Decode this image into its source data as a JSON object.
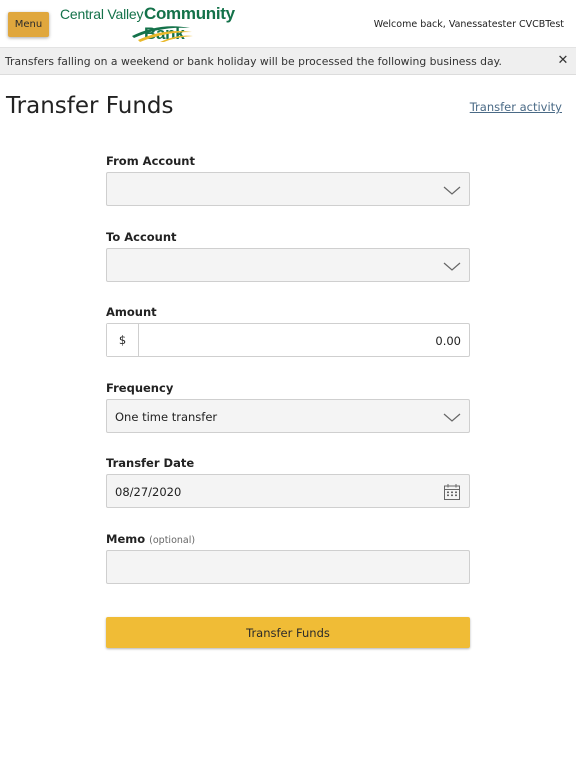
{
  "header": {
    "menu_label": "Menu",
    "logo_text_1": "Central Valley",
    "logo_text_2": "Community Bank",
    "welcome": "Welcome back, Vanessatester CVCBTest",
    "logo_colors": {
      "green": "#14724a",
      "yellow": "#e9b92b"
    }
  },
  "banner": {
    "message": "Transfers falling on a weekend or bank holiday will be processed the following business day.",
    "close_icon": "close-icon"
  },
  "page": {
    "title": "Transfer Funds",
    "activity_link": "Transfer activity"
  },
  "form": {
    "from_account": {
      "label": "From Account",
      "value": ""
    },
    "to_account": {
      "label": "To Account",
      "value": ""
    },
    "amount": {
      "label": "Amount",
      "prefix": "$",
      "value": "0.00"
    },
    "frequency": {
      "label": "Frequency",
      "value": "One time transfer"
    },
    "transfer_date": {
      "label": "Transfer Date",
      "value": "08/27/2020",
      "icon": "calendar-icon"
    },
    "memo": {
      "label": "Memo",
      "optional": "(optional)",
      "value": ""
    },
    "submit_label": "Transfer Funds"
  },
  "colors": {
    "menu_button": "#e0a73d",
    "submit_button": "#f0bc36",
    "link": "#4a6a86"
  }
}
